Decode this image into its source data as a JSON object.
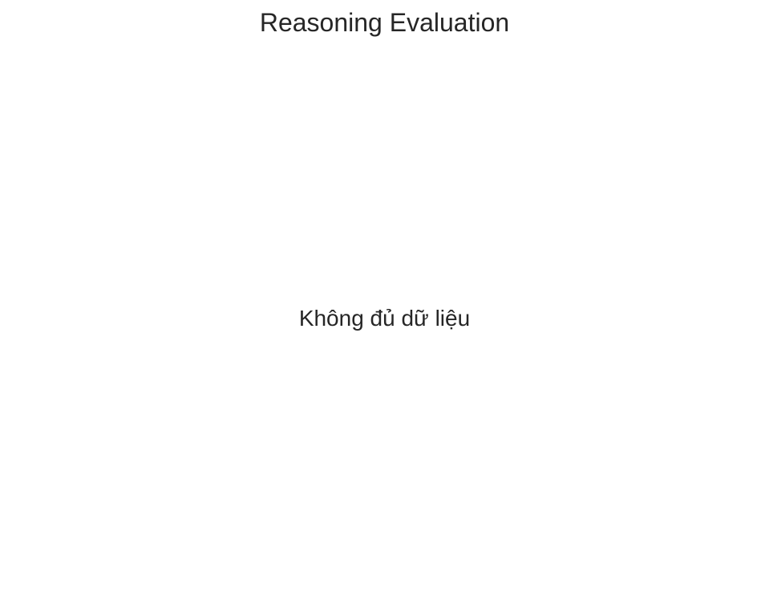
{
  "chart_data": {
    "type": "bar",
    "title": "Reasoning Evaluation",
    "message": "Không đủ dữ liệu",
    "categories": [],
    "values": [],
    "grid": false
  },
  "colors": {
    "background": "#ffffff",
    "text": "#262626"
  }
}
